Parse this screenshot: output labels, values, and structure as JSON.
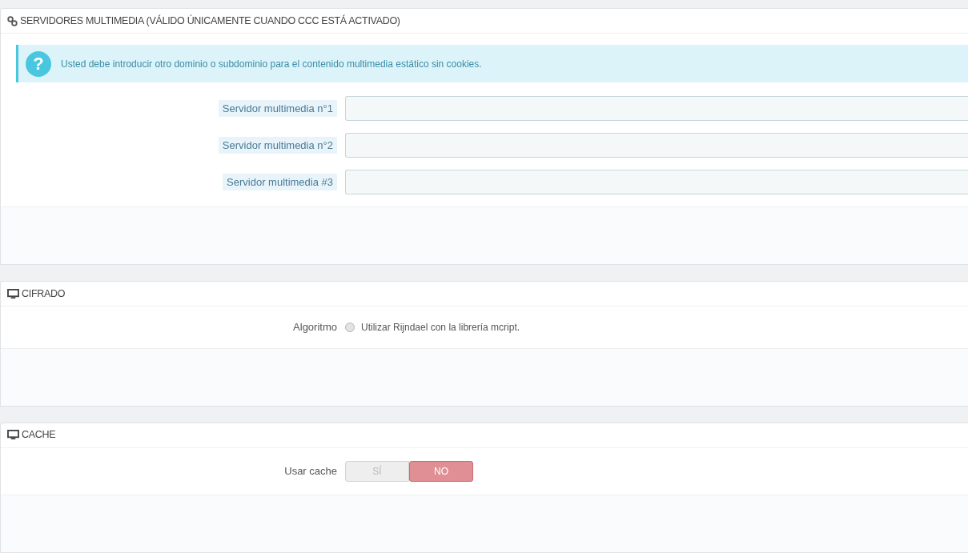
{
  "panels": [
    {
      "title": "SERVIDORES MULTIMEDIA (VÁLIDO ÚNICAMENTE CUANDO CCC ESTÁ ACTIVADO)",
      "alert_icon": "?",
      "alert": "Usted debe introducir otro dominio o subdominio para el contenido multimedia estático sin cookies.",
      "rows": [
        {
          "kind": "text",
          "label": "Servidor multimedia n°1",
          "hint": true
        },
        {
          "kind": "text",
          "label": "Servidor multimedia n°2",
          "hint": true
        },
        {
          "kind": "text",
          "label": "Servidor multimedia #3",
          "hint": true
        }
      ]
    },
    {
      "title": "CIFRADO",
      "rows": [
        {
          "kind": "radio",
          "label": "Algoritmo",
          "hint": false,
          "option": "Utilizar Rijndael con la librería mcript.",
          "selected": false
        }
      ]
    },
    {
      "title": "CACHE",
      "rows": [
        {
          "kind": "switch",
          "label": "Usar cache",
          "hint": false,
          "options": [
            {
              "label": "SÍ",
              "selected": false
            },
            {
              "label": "NO",
              "selected": true
            }
          ]
        }
      ]
    }
  ]
}
